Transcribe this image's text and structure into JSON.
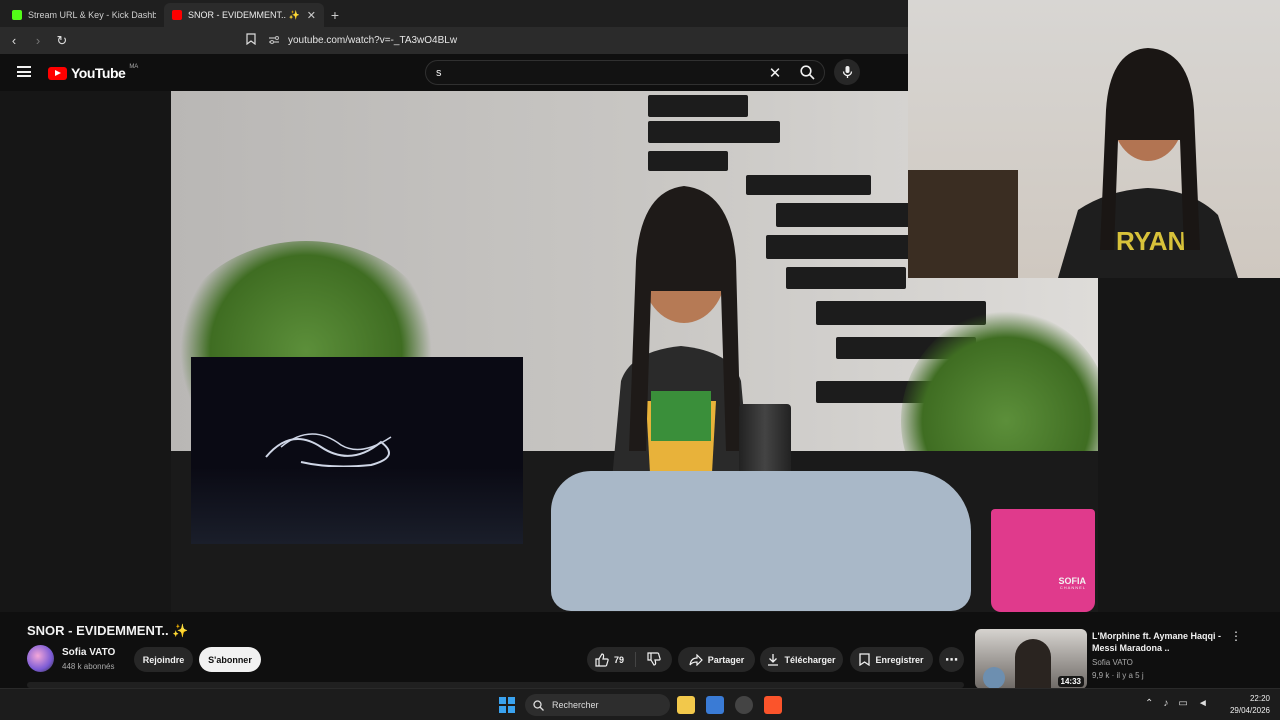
{
  "browser": {
    "tabs": [
      {
        "title": "Stream URL & Key - Kick Dashboard",
        "favicon_color": "#53fc18"
      },
      {
        "title": "SNOR - EVIDEMMENT.. ✨ - YouTube",
        "favicon_color": "#ff0000"
      }
    ],
    "new_tab": "+",
    "url": "youtube.com/watch?v=-_TA3wO4BLw"
  },
  "youtube": {
    "logo_text": "YouTube",
    "region": "MA",
    "search_value": "s"
  },
  "video": {
    "watermark": "SOFIA",
    "watermark_sub": "CHANNEL",
    "title": "SNOR - EVIDEMMENT.. ✨",
    "channel": "Sofia VATO",
    "subscribers": "448 k abonnés",
    "join_label": "Rejoindre",
    "subscribe_label": "S'abonner",
    "likes": "79",
    "share_label": "Partager",
    "download_label": "Télécharger",
    "save_label": "Enregistrer"
  },
  "recommendation": {
    "title": "L'Morphine ft. Aymane Haqqi - Messi Maradona ..",
    "channel": "Sofia VATO",
    "views": "9,9 k",
    "age": "il y a 5 j",
    "duration": "14:33"
  },
  "taskbar": {
    "search_label": "Rechercher",
    "time": "22:20",
    "date": "29/04/2026"
  },
  "colors": {
    "accent": "#ff0000",
    "background": "#0f0f0f"
  }
}
